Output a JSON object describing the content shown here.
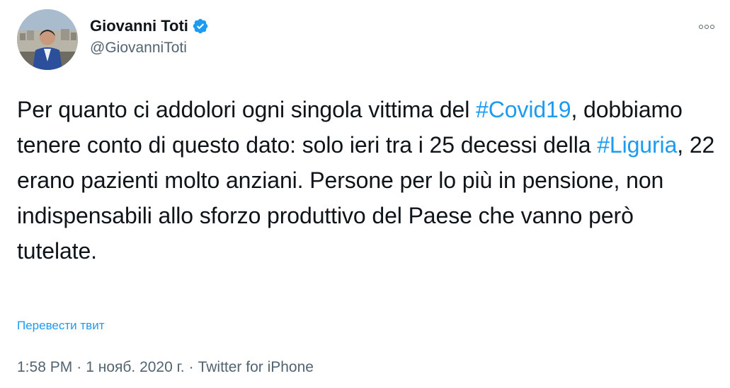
{
  "author": {
    "display_name": "Giovanni Toti",
    "handle": "@GiovanniToti",
    "verified": true
  },
  "tweet": {
    "segments": [
      {
        "text": "Per quanto ci addolori ogni singola vittima del ",
        "type": "text"
      },
      {
        "text": "#Covid19",
        "type": "hashtag"
      },
      {
        "text": ", dobbiamo tenere conto di questo dato: solo ieri tra i 25 decessi della ",
        "type": "text"
      },
      {
        "text": "#Liguria",
        "type": "hashtag"
      },
      {
        "text": ", 22 erano pazienti molto anziani. Persone per lo più in pensione, non indispensabili allo sforzo produttivo del Paese che vanno però tutelate.",
        "type": "text"
      }
    ],
    "translate_label": "Перевести твит"
  },
  "meta": {
    "time": "1:58 PM",
    "separator": "·",
    "date": "1 нояб. 2020 г.",
    "source": "Twitter for iPhone"
  },
  "colors": {
    "link": "#1d9bf0",
    "secondary_text": "#536471",
    "primary_text": "#0f1419"
  },
  "icons": {
    "more": "more-options-icon",
    "verified": "verified-badge-icon"
  }
}
